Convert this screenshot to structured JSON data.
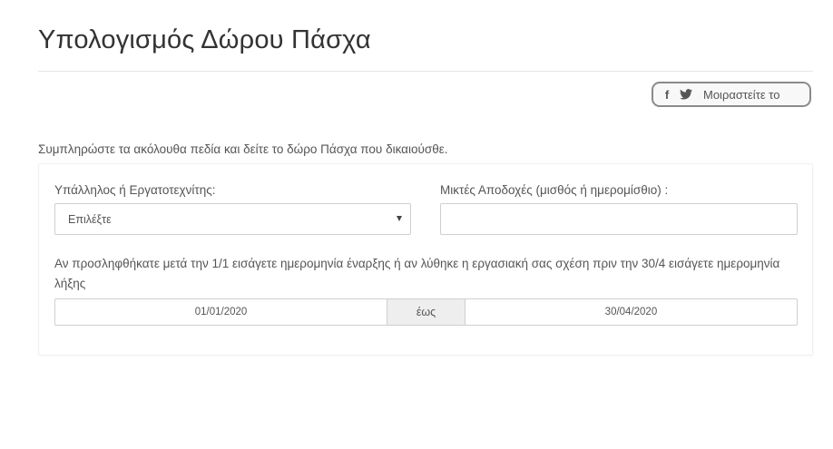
{
  "page": {
    "title": "Υπολογισμός Δώρου Πάσχα"
  },
  "share": {
    "facebook_icon": "f",
    "twitter_icon": "twitter-bird",
    "label": "Μοιραστείτε το"
  },
  "form": {
    "intro": "Συμπληρώστε τα ακόλουθα πεδία και δείτε το δώρο Πάσχα που δικαιούσθε.",
    "employee_type": {
      "label": "Υπάλληλος ή Εργατοτεχνίτης:",
      "selected": "Επιλέξτε"
    },
    "wage": {
      "label": "Μικτές Αποδοχές (μισθός ή ημερομίσθιο) :",
      "value": ""
    },
    "date_help": "Αν προσληφθήκατε μετά την 1/1 εισάγετε ημερομηνία έναρξης ή αν λύθηκε η εργασιακή σας σχέση πριν την 30/4 εισάγετε ημερομηνία λήξης",
    "date_range": {
      "start": "01/01/2020",
      "separator": "έως",
      "end": "30/04/2020"
    }
  }
}
